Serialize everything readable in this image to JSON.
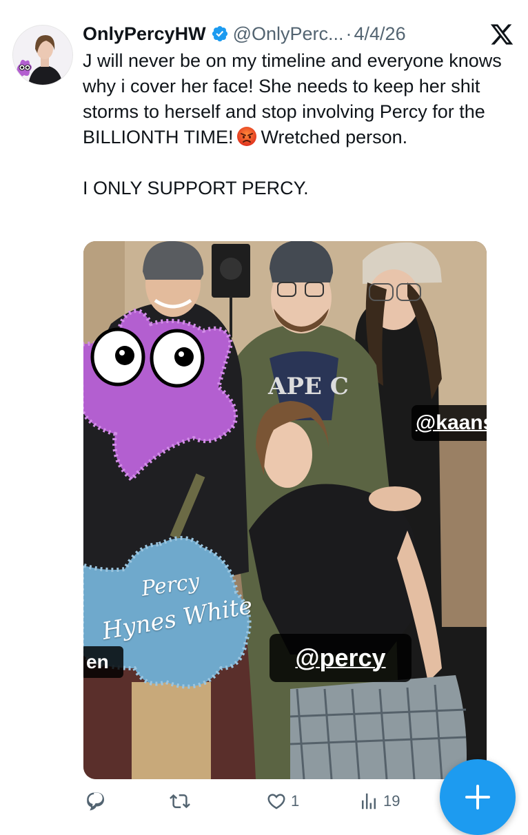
{
  "tweet": {
    "display_name": "OnlyPercyHW",
    "handle": "@OnlyPerc...",
    "separator": "·",
    "date": "4/4/26",
    "text_part1": "J will never be on my timeline and everyone knows why i cover her face!  She needs to keep her shit storms to herself and stop involving Percy for the BILLIONTH TIME!",
    "text_part2": "Wretched person.",
    "text_line2": "I ONLY SUPPORT PERCY.",
    "emoji": "angry-face"
  },
  "media": {
    "tag_kaans": "@kaans",
    "tag_percy": "@percy",
    "tag_left": "en",
    "signature_line1": "Percy",
    "signature_line2": "Hynes White"
  },
  "actions": {
    "reply_count": "",
    "retweet_count": "",
    "like_count": "1",
    "views_count": "19"
  },
  "colors": {
    "accent": "#1d9bf0",
    "secondary_text": "#536471",
    "primary_text": "#0f1419",
    "purple_sticker": "#b35fd0",
    "blue_sticker": "#6fa9cc"
  }
}
